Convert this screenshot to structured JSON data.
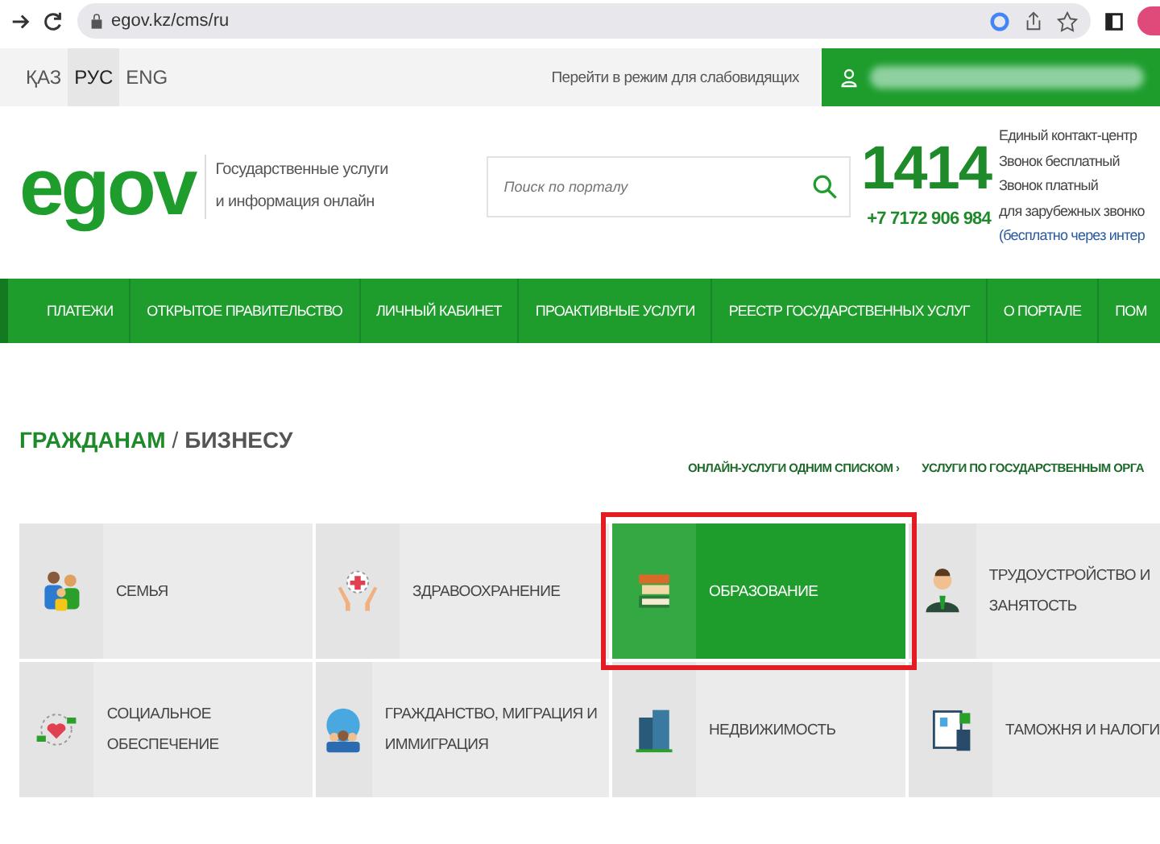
{
  "browser": {
    "url": "egov.kz/cms/ru"
  },
  "top_bar": {
    "languages": [
      {
        "label": "ҚАЗ",
        "selected": false
      },
      {
        "label": "РУС",
        "selected": true
      },
      {
        "label": "ENG",
        "selected": false
      }
    ],
    "accessibility_link": "Перейти в режим для слабовидящих"
  },
  "header": {
    "logo": "egov",
    "tagline": [
      "Государственные услуги",
      "и информация онлайн"
    ],
    "search": {
      "placeholder": "Поиск по порталу"
    },
    "phone_short": "1414",
    "phone_long": "+7 7172 906 984",
    "contact_lines": [
      "Единый контакт-центр",
      "Звонок бесплатный",
      "Звонок платный",
      "для зарубежных звонко",
      "(бесплатно через интер"
    ]
  },
  "nav": [
    "ПЛАТЕЖИ",
    "ОТКРЫТОЕ ПРАВИТЕЛЬСТВО",
    "ЛИЧНЫЙ КАБИНЕТ",
    "ПРОАКТИВНЫЕ УСЛУГИ",
    "РЕЕСТР ГОСУДАРСТВЕННЫХ УСЛУГ",
    "О ПОРТАЛЕ",
    "ПОМ"
  ],
  "section": {
    "title_active": "ГРАЖДАНАМ",
    "separator": "/",
    "title_other": "БИЗНЕСУ",
    "links": [
      "ОНЛАЙН-УСЛУГИ ОДНИМ СПИСКОМ ›",
      "УСЛУГИ ПО ГОСУДАРСТВЕННЫМ ОРГА"
    ]
  },
  "tiles": [
    {
      "label": "СЕМЬЯ",
      "kind": "family",
      "selected": false
    },
    {
      "label": "ЗДРАВООХРАНЕНИЕ",
      "kind": "health",
      "selected": false
    },
    {
      "label": "ОБРАЗОВАНИЕ",
      "kind": "books",
      "selected": true
    },
    {
      "label": "ТРУДОУСТРОЙСТВО И ЗАНЯТОСТЬ",
      "kind": "worker",
      "selected": false
    },
    {
      "label": "СОЦИАЛЬНОЕ ОБЕСПЕЧЕНИЕ",
      "kind": "heart",
      "selected": false
    },
    {
      "label": "ГРАЖДАНСТВО, МИГРАЦИЯ И ИММИГРАЦИЯ",
      "kind": "globe",
      "selected": false
    },
    {
      "label": "НЕДВИЖИМОСТЬ",
      "kind": "building",
      "selected": false
    },
    {
      "label": "ТАМОЖНЯ И НАЛОГИ",
      "kind": "docs",
      "selected": false
    }
  ]
}
